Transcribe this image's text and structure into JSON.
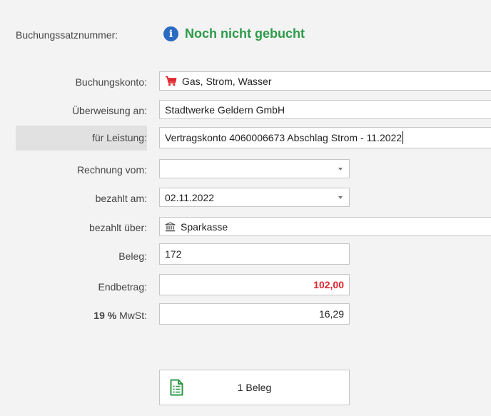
{
  "header": {
    "label": "Buchungssatznummer:",
    "status": "Noch nicht gebucht"
  },
  "form": {
    "buchungskonto": {
      "label": "Buchungskonto:",
      "value": "Gas, Strom, Wasser",
      "icon": "shopping-cart-icon",
      "icon_color": "#e0262f"
    },
    "ueberweisung": {
      "label": "Überweisung an:",
      "value": "Stadtwerke Geldern GmbH"
    },
    "leistung": {
      "label": "für Leistung:",
      "value": "Vertragskonto 4060006673 Abschlag Strom - 11.2022"
    },
    "rechnung_vom": {
      "label": "Rechnung vom:",
      "value": ""
    },
    "bezahlt_am": {
      "label": "bezahlt am:",
      "value": "02.11.2022"
    },
    "bezahlt_ueber": {
      "label": "bezahlt über:",
      "value": "Sparkasse",
      "icon": "bank-icon"
    },
    "beleg": {
      "label": "Beleg:",
      "value": "172"
    },
    "endbetrag": {
      "label": "Endbetrag:",
      "value": "102,00",
      "color": "#e0262f"
    },
    "mwst": {
      "rate": "19 %",
      "label": " MwSt:",
      "value": "16,29"
    }
  },
  "beleg_button": {
    "label": "1 Beleg",
    "icon": "document-list-icon",
    "icon_color": "#2d9a4a"
  },
  "colors": {
    "status": "#2d9a4a",
    "info": "#2b6bc4",
    "accent_red": "#e0262f"
  }
}
